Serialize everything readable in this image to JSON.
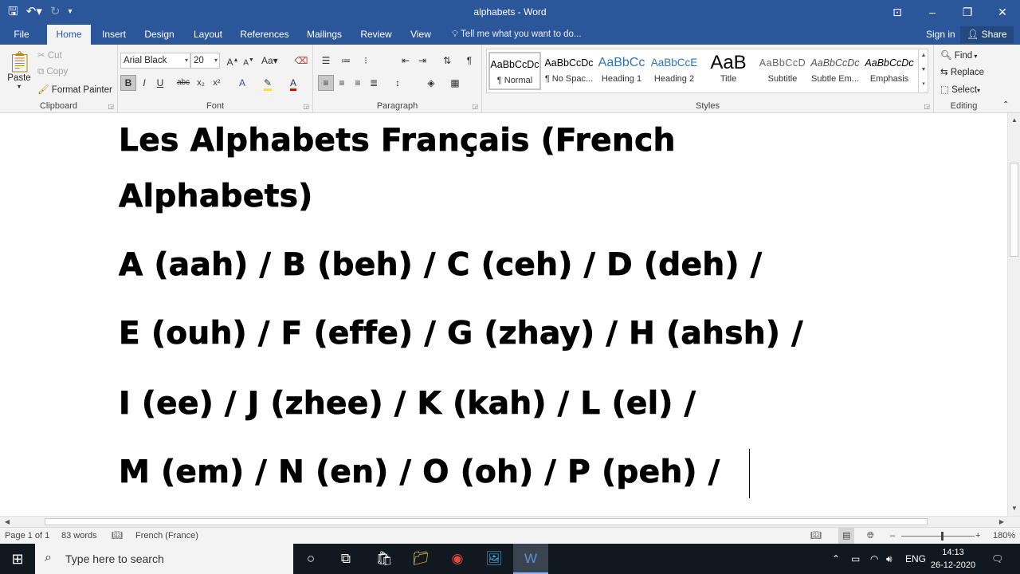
{
  "window": {
    "title": "alphabets - Word"
  },
  "qat": {
    "save_icon": "save-icon",
    "undo_icon": "undo-icon",
    "redo_icon": "redo-icon"
  },
  "tabs": [
    {
      "label": "File"
    },
    {
      "label": "Home"
    },
    {
      "label": "Insert"
    },
    {
      "label": "Design"
    },
    {
      "label": "Layout"
    },
    {
      "label": "References"
    },
    {
      "label": "Mailings"
    },
    {
      "label": "Review"
    },
    {
      "label": "View"
    }
  ],
  "tell_me": "Tell me what you want to do...",
  "sign_in": "Sign in",
  "share": "Share",
  "clipboard": {
    "paste": "Paste",
    "cut": "Cut",
    "copy": "Copy",
    "format_painter": "Format Painter",
    "label": "Clipboard"
  },
  "font": {
    "name": "Arial Black",
    "size": "20",
    "label": "Font",
    "buttons": {
      "bold": "B",
      "italic": "I",
      "underline": "U",
      "strike": "abc",
      "sub": "x₂",
      "sup": "x²",
      "grow": "A",
      "shrink": "A",
      "case": "Aa"
    }
  },
  "paragraph": {
    "label": "Paragraph"
  },
  "styles": {
    "label": "Styles",
    "items": [
      {
        "preview": "AaBbCcDc",
        "name": "¶ Normal"
      },
      {
        "preview": "AaBbCcDc",
        "name": "¶ No Spac..."
      },
      {
        "preview": "AaBbCc",
        "name": "Heading 1"
      },
      {
        "preview": "AaBbCcE",
        "name": "Heading 2"
      },
      {
        "preview": "AaB",
        "name": "Title"
      },
      {
        "preview": "AaBbCcD",
        "name": "Subtitle"
      },
      {
        "preview": "AaBbCcDc",
        "name": "Subtle Em..."
      },
      {
        "preview": "AaBbCcDc",
        "name": "Emphasis"
      }
    ]
  },
  "editing": {
    "find": "Find",
    "replace": "Replace",
    "select": "Select",
    "label": "Editing"
  },
  "document": {
    "lines": [
      "Les Alphabets Français (French",
      "Alphabets)",
      "A (aah) / B (beh) / C (ceh) / D (deh) /",
      "E (ouh) / F (effe) / G (zhay) / H (ahsh) /",
      "I (ee) / J (zhee) / K (kah) / L (el) /",
      "M (em) / N (en) / O (oh) / P (peh) /"
    ]
  },
  "status": {
    "page": "Page 1 of 1",
    "words": "83 words",
    "language": "French (France)",
    "zoom": "180%"
  },
  "taskbar": {
    "search_placeholder": "Type here to search",
    "lang": "ENG",
    "time": "14:13",
    "date": "26-12-2020"
  }
}
